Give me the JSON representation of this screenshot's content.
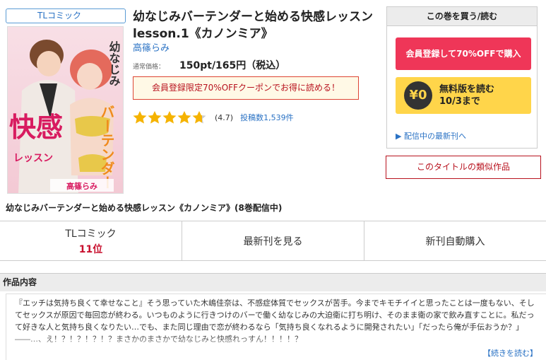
{
  "product": {
    "genre_tag": "TLコミック",
    "title": "幼なじみバーテンダーと始める快感レッスン lesson.1《カノンミア》",
    "author": "高篠らみ",
    "price_label": "通常価格：",
    "price": "150pt/165円（税込）",
    "coupon_text": "会員登録限定70%OFFクーポンでお得に読める！",
    "rating_value": "(4.7)",
    "rating_stars": 4.7,
    "review_count": "投稿数1,539件",
    "series_title": "幼なじみバーテンダーと始める快感レッスン《カノンミア》(8巻配信中)"
  },
  "cover": {
    "title_vertical_1": "幼なじみ",
    "title_vertical_2": "バーテンダー",
    "title_big": "快感",
    "title_sub": "レッスン",
    "author": "高篠らみ"
  },
  "buy_panel": {
    "header": "この巻を買う/読む",
    "member_button": "会員登録して70%OFFで購入",
    "free_yen": "¥0",
    "free_line1": "無料版を読む",
    "free_line2": "10/3まで",
    "latest_link": "▶ 配信中の最新刊へ"
  },
  "similar_button": "このタイトルの類似作品",
  "actions": {
    "ranking_label": "TLコミック",
    "ranking_value": "11位",
    "latest": "最新刊を見る",
    "auto_buy": "新刊自動購入"
  },
  "description": {
    "heading": "作品内容",
    "text": "『エッチは気持ち良くて幸せなこと』そう思っていた木嶋佳奈は、不感症体質でセックスが苦手。今までキモチイイと思ったことは一度もない、そしてセックスが原因で毎回恋が終わる。いつものように行きつけのバーで働く幼なじみの大迫衛に打ち明け、そのまま衛の家で飲み直すことに。私だって好きな人と気持ち良くなりたい…でも、また同じ理由で恋が終わるなら「気持ち良くなれるように開発されたい」「だったら俺が手伝おうか？」――…、え！？！？！？！？まさかのまさかで幼なじみと快感れっすん！！！！？",
    "read_more": "【続きを読む】"
  },
  "colors": {
    "accent_red": "#ef3658",
    "free_yellow": "#ffd54a",
    "link_blue": "#2a72c4",
    "star_gold": "#f5b301"
  }
}
